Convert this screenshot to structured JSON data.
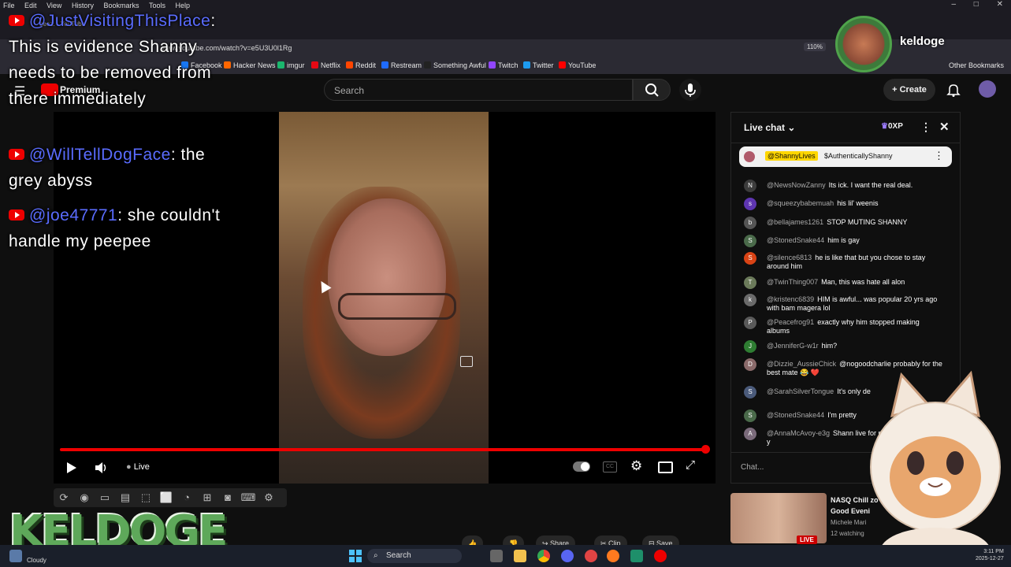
{
  "browser": {
    "menu": [
      "File",
      "Edit",
      "View",
      "History",
      "Bookmarks",
      "Tools",
      "Help"
    ],
    "tab_title": "geez. - YouTube",
    "url": "www.youtube.com/watch?v=e5U3U0l1Rg",
    "zoom": "110%",
    "bookmarks": [
      {
        "label": "Facebook",
        "color": "#1877f2"
      },
      {
        "label": "Hacker News",
        "color": "#ff6600"
      },
      {
        "label": "imgur",
        "color": "#1bb76e"
      },
      {
        "label": "Netflix",
        "color": "#e50914"
      },
      {
        "label": "Reddit",
        "color": "#ff4500"
      },
      {
        "label": "Restream",
        "color": "#1f6bff"
      },
      {
        "label": "Something Awful",
        "color": "#222222"
      },
      {
        "label": "Twitch",
        "color": "#9146ff"
      },
      {
        "label": "Twitter",
        "color": "#1d9bf0"
      },
      {
        "label": "YouTube",
        "color": "#ff0000"
      }
    ],
    "other_bookmarks": "Other Bookmarks"
  },
  "youtube": {
    "logo_text": "Premium",
    "search_placeholder": "Search",
    "create_label": "Create",
    "player": {
      "live_label": "Live",
      "progress": 1.0
    },
    "chat": {
      "title": "Live chat",
      "xp": "0XP",
      "pinned_user": "@ShannyLives",
      "pinned_text": "$AuthenticallyShanny",
      "messages": [
        {
          "user": "@NewsNowZanny",
          "text": "Its ick. I want the real deal.",
          "initial": "N",
          "color": "#3c3c3c"
        },
        {
          "user": "@squeezybabemuah",
          "text": "his lil' weenis",
          "initial": "s",
          "color": "#5e35b1"
        },
        {
          "user": "@bellajames1261",
          "text": "STOP MUTING SHANNY",
          "initial": "b",
          "color": "#555555"
        },
        {
          "user": "@StonedSnake44",
          "text": "him is gay",
          "initial": "S",
          "color": "#4a6a4a"
        },
        {
          "user": "@silence6813",
          "text": "he is like that but you chose to stay around him",
          "initial": "S",
          "color": "#d84315"
        },
        {
          "user": "@TwinThing007",
          "text": "Man, this was hate all alon",
          "initial": "T",
          "color": "#6b7a5a"
        },
        {
          "user": "@kristenc6839",
          "text": "HIM is awful... was popular 20 yrs ago with bam magera lol",
          "initial": "k",
          "color": "#6a6a6a"
        },
        {
          "user": "@Peacefrog91",
          "text": "exactly why him stopped making albums",
          "initial": "P",
          "color": "#5a5a5a"
        },
        {
          "user": "@JenniferG-w1r",
          "text": "him?",
          "initial": "J",
          "color": "#2e7d32"
        },
        {
          "user": "@Dizzie_AussieChick",
          "text": "@nogoodcharlie probably for the best mate 😂 ❤️",
          "initial": "D",
          "color": "#8a6a6a"
        },
        {
          "user": "@SarahSilverTongue",
          "text": "It's only de",
          "initial": "S",
          "color": "#4a5a7a"
        },
        {
          "user": "@StonedSnake44",
          "text": "I'm pretty",
          "initial": "S",
          "color": "#4a6a4a"
        },
        {
          "user": "@AnnaMcAvoy-e3g",
          "text": "Shann live for protection? Why do y",
          "initial": "A",
          "color": "#7a6a7a"
        }
      ],
      "input_placeholder": "Chat..."
    },
    "recommended": {
      "title": "NASQ Chill zo Good Eveni",
      "channel": "Michele Mari",
      "watching": "12 watching",
      "badge": "LIVE"
    },
    "actions": [
      "Share",
      "Clip",
      "Save"
    ]
  },
  "overlay": {
    "streamer_name": "keldoge",
    "logo": "KELDOGE",
    "chat": [
      {
        "user": "@JustVisitingThisPlace",
        "text": "This is evidence Shanny needs to be removed from there immediately"
      },
      {
        "user": "@WillTellDogFace",
        "text": "the grey abyss"
      },
      {
        "user": "@joe47771",
        "text": "she couldn't handle my peepee"
      }
    ]
  },
  "taskbar": {
    "search": "Search",
    "weather": "Cloudy",
    "time": "3:11 PM",
    "date": "2025-12-27"
  }
}
